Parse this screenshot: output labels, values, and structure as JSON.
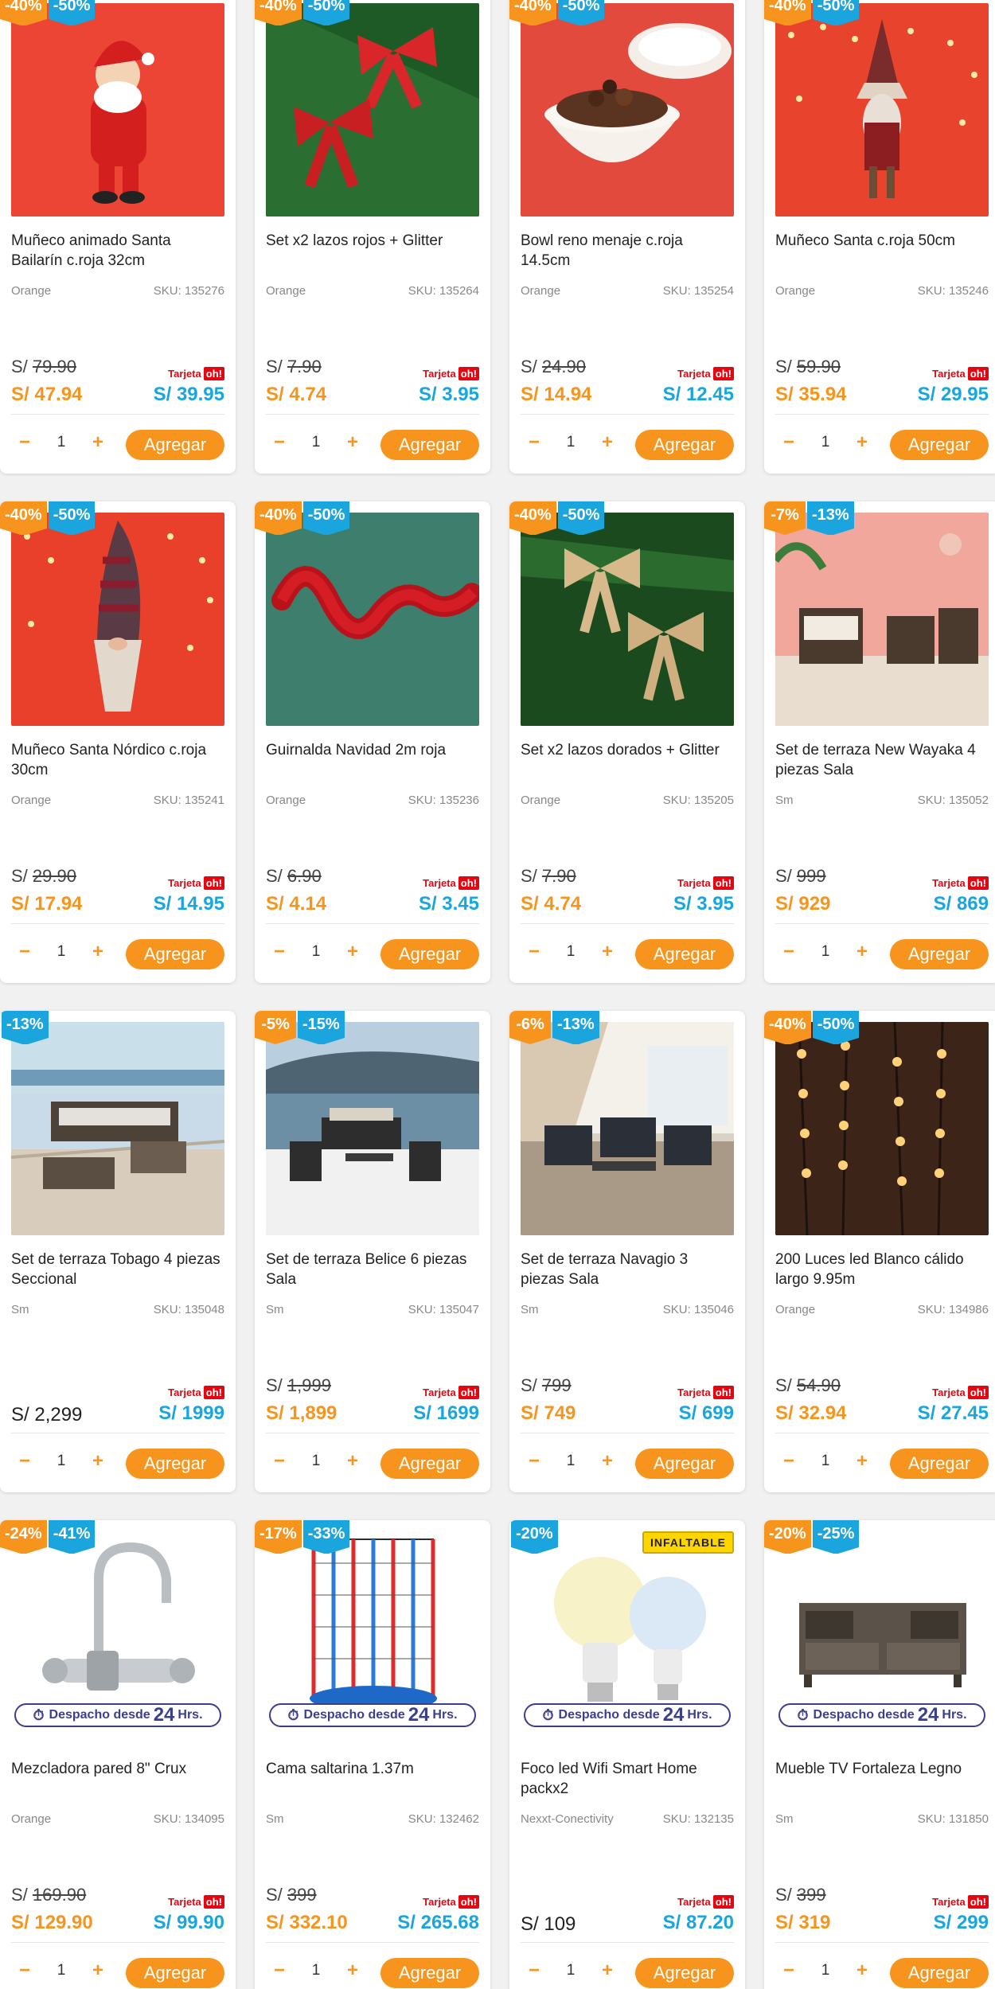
{
  "ui": {
    "add_label": "Agregar",
    "tarjeta_label": "Tarjeta",
    "oh_label": "oh!",
    "despacho_text": "Despacho desde",
    "despacho_hours": "24",
    "despacho_unit": "Hrs.",
    "qty_minus": "−",
    "qty_plus": "+",
    "colors": {
      "orange": "#f7941d",
      "blue": "#1aa5df",
      "ohred": "#e30613",
      "despacho": "#3b3f8f"
    }
  },
  "products": [
    {
      "badge_a": "-40%",
      "badge_b": "-50%",
      "name": "Muñeco animado Santa Bailarín c.roja 32cm",
      "brand": "Orange",
      "sku": "SKU: 135276",
      "old_price": "79.90",
      "price": "S/ 47.94",
      "card_price": "S/ 39.95",
      "qty": "1",
      "image_icon": "santa-icon",
      "image_bg": "#ec4535"
    },
    {
      "badge_a": "-40%",
      "badge_b": "-50%",
      "name": "Set x2 lazos rojos + Glitter",
      "brand": "Orange",
      "sku": "SKU: 135264",
      "old_price": "7.90",
      "price": "S/ 4.74",
      "card_price": "S/ 3.95",
      "qty": "1",
      "image_icon": "red-bow-icon",
      "image_bg": "#e8352e"
    },
    {
      "badge_a": "-40%",
      "badge_b": "-50%",
      "name": "Bowl reno menaje c.roja 14.5cm",
      "brand": "Orange",
      "sku": "SKU: 135254",
      "old_price": "24.90",
      "price": "S/ 14.94",
      "card_price": "S/ 12.45",
      "qty": "1",
      "image_icon": "bowl-icon",
      "image_bg": "#e24a3d"
    },
    {
      "badge_a": "-40%",
      "badge_b": "-50%",
      "name": "Muñeco Santa c.roja 50cm",
      "brand": "Orange",
      "sku": "SKU: 135246",
      "old_price": "59.90",
      "price": "S/ 35.94",
      "card_price": "S/ 29.95",
      "qty": "1",
      "image_icon": "gnome-icon",
      "image_bg": "#e8432c"
    },
    {
      "badge_a": "-40%",
      "badge_b": "-50%",
      "name": "Muñeco Santa Nórdico c.roja 30cm",
      "brand": "Orange",
      "sku": "SKU: 135241",
      "old_price": "29.90",
      "price": "S/ 17.94",
      "card_price": "S/ 14.95",
      "qty": "1",
      "image_icon": "nordic-gnome-icon",
      "image_bg": "#e8402b"
    },
    {
      "badge_a": "-40%",
      "badge_b": "-50%",
      "name": "Guirnalda Navidad 2m roja",
      "brand": "Orange",
      "sku": "SKU: 135236",
      "old_price": "6.90",
      "price": "S/ 4.14",
      "card_price": "S/ 3.45",
      "qty": "1",
      "image_icon": "garland-icon",
      "image_bg": "#3e7e6c"
    },
    {
      "badge_a": "-40%",
      "badge_b": "-50%",
      "name": "Set x2 lazos dorados + Glitter",
      "brand": "Orange",
      "sku": "SKU: 135205",
      "old_price": "7.90",
      "price": "S/ 4.74",
      "card_price": "S/ 3.95",
      "qty": "1",
      "image_icon": "gold-bow-icon",
      "image_bg": "#1f4a22"
    },
    {
      "badge_a": "-7%",
      "badge_b": "-13%",
      "name": "Set de terraza New Wayaka 4 piezas Sala",
      "brand": "Sm",
      "sku": "SKU: 135052",
      "old_price": "999",
      "price": "S/ 929",
      "card_price": "S/ 869",
      "qty": "1",
      "image_icon": "patio-set-icon",
      "image_bg": "#f1a79b"
    },
    {
      "badge_a": "",
      "badge_b": "-13%",
      "name": "Set de terraza Tobago 4 piezas Seccional",
      "brand": "Sm",
      "sku": "SKU: 135048",
      "old_price": "",
      "price": "S/ 2,299",
      "card_price": "S/ 1999",
      "qty": "1",
      "image_icon": "sectional-sofa-icon",
      "image_bg": "#c9dbe8"
    },
    {
      "badge_a": "-5%",
      "badge_b": "-15%",
      "name": "Set de terraza Belice 6 piezas Sala",
      "brand": "Sm",
      "sku": "SKU: 135047",
      "old_price": "1,999",
      "price": "S/ 1,899",
      "card_price": "S/ 1699",
      "qty": "1",
      "image_icon": "terrace-set-icon",
      "image_bg": "#9fb8cc"
    },
    {
      "badge_a": "-6%",
      "badge_b": "-13%",
      "name": "Set de terraza Navagio 3 piezas Sala",
      "brand": "Sm",
      "sku": "SKU: 135046",
      "old_price": "799",
      "price": "S/ 749",
      "card_price": "S/ 699",
      "qty": "1",
      "image_icon": "terrace-chairs-icon",
      "image_bg": "#d9d2c6"
    },
    {
      "badge_a": "-40%",
      "badge_b": "-50%",
      "name": "200 Luces led Blanco cálido largo 9.95m",
      "brand": "Orange",
      "sku": "SKU: 134986",
      "old_price": "54.90",
      "price": "S/ 32.94",
      "card_price": "S/ 27.45",
      "qty": "1",
      "image_icon": "string-lights-icon",
      "image_bg": "#5a3522"
    },
    {
      "badge_a": "-24%",
      "badge_b": "-41%",
      "name": "Mezcladora pared 8\" Crux",
      "brand": "Orange",
      "sku": "SKU: 134095",
      "old_price": "169.90",
      "price": "S/ 129.90",
      "card_price": "S/ 99.90",
      "qty": "1",
      "image_icon": "faucet-icon",
      "image_bg": "#ffffff",
      "despacho": true
    },
    {
      "badge_a": "-17%",
      "badge_b": "-33%",
      "name": "Cama saltarina 1.37m",
      "brand": "Sm",
      "sku": "SKU: 132462",
      "old_price": "399",
      "price": "S/ 332.10",
      "card_price": "S/ 265.68",
      "qty": "1",
      "image_icon": "trampoline-icon",
      "image_bg": "#ffffff",
      "despacho": true
    },
    {
      "badge_a": "",
      "badge_b": "-20%",
      "name": "Foco led Wifi Smart Home packx2",
      "brand": "Nexxt-Conectivity",
      "sku": "SKU: 132135",
      "old_price": "",
      "price": "S/ 109",
      "card_price": "S/ 87.20",
      "qty": "1",
      "image_icon": "lightbulb-icon",
      "image_bg": "#ffffff",
      "despacho": true,
      "tag": "INFALTABLE"
    },
    {
      "badge_a": "-20%",
      "badge_b": "-25%",
      "name": "Mueble TV Fortaleza Legno",
      "brand": "Sm",
      "sku": "SKU: 131850",
      "old_price": "399",
      "price": "S/ 319",
      "card_price": "S/ 299",
      "qty": "1",
      "image_icon": "tv-stand-icon",
      "image_bg": "#ffffff",
      "despacho": true
    }
  ]
}
